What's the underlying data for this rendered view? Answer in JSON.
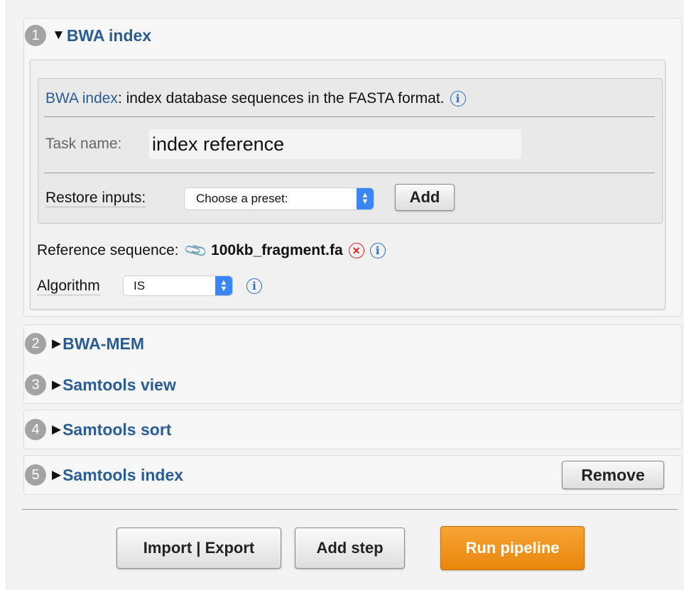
{
  "steps": [
    {
      "number": "1",
      "title": "BWA index",
      "expanded": true
    },
    {
      "number": "2",
      "title": "BWA-MEM",
      "expanded": false
    },
    {
      "number": "3",
      "title": "Samtools view",
      "expanded": false
    },
    {
      "number": "4",
      "title": "Samtools sort",
      "expanded": false
    },
    {
      "number": "5",
      "title": "Samtools index",
      "expanded": false
    }
  ],
  "tool": {
    "name": "BWA index",
    "description": ": index database sequences in the FASTA format."
  },
  "task": {
    "label": "Task name:",
    "value": "index reference"
  },
  "restore": {
    "label": "Restore inputs:",
    "preset_placeholder": "Choose a preset:",
    "add_label": "Add"
  },
  "reference": {
    "label": "Reference sequence:",
    "file": "100kb_fragment.fa"
  },
  "algorithm": {
    "label": "Algorithm",
    "selected": "IS"
  },
  "remove_label": "Remove",
  "footer": {
    "import_export": "Import | Export",
    "add_step": "Add step",
    "run_pipeline": "Run pipeline"
  },
  "icons": {
    "info": "info-icon",
    "remove": "x-circle-icon",
    "attachment": "paperclip-icon",
    "expanded": "triangle-down-icon",
    "collapsed": "triangle-right-icon"
  },
  "colors": {
    "link": "#2a5d94",
    "run_button": "#f0951f",
    "select_accent": "#3b86f7",
    "remove_icon": "#e02020"
  }
}
